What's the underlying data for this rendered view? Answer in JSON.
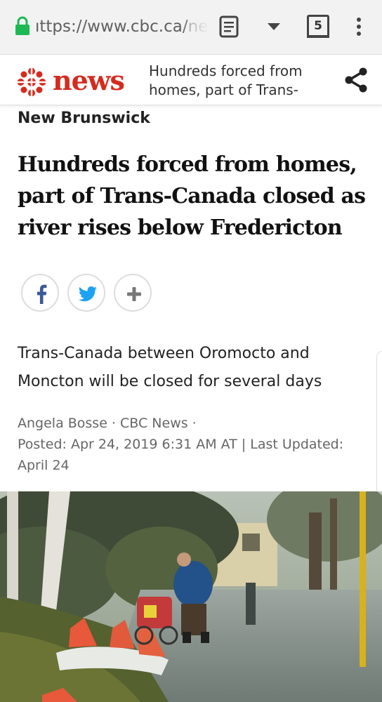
{
  "browser": {
    "url_primary": "ıttps://www.cbc.ca/",
    "url_faded": "ne",
    "tab_count": "5",
    "icons": [
      "lock-icon",
      "reader-mode-icon",
      "dropdown-icon",
      "tabs-icon",
      "more-options-icon"
    ]
  },
  "header": {
    "wordmark": "news",
    "title": "Hundreds forced from homes, part of Trans-",
    "brand_color": "#d52b1e",
    "icons": [
      "cbc-gem-logo",
      "share-icon"
    ]
  },
  "article": {
    "section": "New Brunswick",
    "headline": "Hundreds forced from homes, part of Trans-Canada closed as river rises below Fredericton",
    "deck": "Trans-Canada between Oromocto and Moncton will be closed for several days",
    "byline_line1": "Angela Bosse · CBC News ·",
    "byline_line2": "Posted: Apr 24, 2019 6:31 AM AT | Last Updated:",
    "byline_line3": "April 24"
  },
  "social": {
    "buttons": [
      "facebook",
      "twitter",
      "more"
    ],
    "facebook_color": "#3b5998",
    "twitter_color": "#1da1f2",
    "more_color": "#777777"
  },
  "photo": {
    "icons": [
      "flooded-street-photo"
    ]
  }
}
